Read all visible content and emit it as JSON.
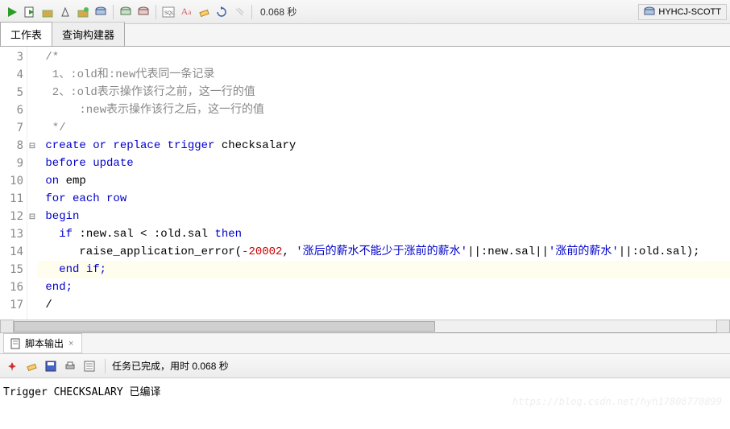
{
  "toolbar": {
    "timing": "0.068 秒"
  },
  "connection": {
    "label": "HYHCJ-SCOTT"
  },
  "tabs": {
    "worksheet": "工作表",
    "queryBuilder": "查询构建器"
  },
  "code": {
    "lines": [
      {
        "n": 3,
        "fold": "",
        "html": "<span class='cm'> /*</span>"
      },
      {
        "n": 4,
        "fold": "",
        "html": "<span class='cm'>  1、:old和:new代表同一条记录</span>"
      },
      {
        "n": 5,
        "fold": "",
        "html": "<span class='cm'>  2、:old表示操作该行之前，这一行的值</span>"
      },
      {
        "n": 6,
        "fold": "",
        "html": "<span class='cm'>      :new表示操作该行之后，这一行的值</span>"
      },
      {
        "n": 7,
        "fold": "",
        "html": "<span class='cm'>  */</span>"
      },
      {
        "n": 8,
        "fold": "⊟",
        "html": " <span class='kw'>create or replace trigger</span> checksalary"
      },
      {
        "n": 9,
        "fold": "",
        "html": " <span class='kw'>before update</span>"
      },
      {
        "n": 10,
        "fold": "",
        "html": " <span class='kw'>on</span> emp"
      },
      {
        "n": 11,
        "fold": "",
        "html": " <span class='kw'>for each row</span>"
      },
      {
        "n": 12,
        "fold": "⊟",
        "html": " <span class='kw'>begin</span>"
      },
      {
        "n": 13,
        "fold": "",
        "html": "   <span class='kw'>if</span> :new.sal &lt; :old.sal <span class='kw'>then</span>"
      },
      {
        "n": 14,
        "fold": "",
        "html": "      raise_application_error(<span class='dash'>-</span><span class='num'>20002</span>, <span class='str'>'涨后的薪水不能少于涨前的薪水'</span>||:new.sal||<span class='str'>'涨前的薪水'</span>||:old.sal);"
      },
      {
        "n": 15,
        "fold": "",
        "hl": true,
        "html": "   <span class='kw'>end if;</span>"
      },
      {
        "n": 16,
        "fold": "",
        "html": " <span class='kw'>end;</span>"
      },
      {
        "n": 17,
        "fold": "",
        "html": " /"
      }
    ]
  },
  "output": {
    "tabLabel": "脚本输出",
    "status": "任务已完成，用时 0.068 秒",
    "body": "Trigger CHECKSALARY 已编译",
    "watermark": "https://blog.csdn.net/hyh17808770899"
  }
}
